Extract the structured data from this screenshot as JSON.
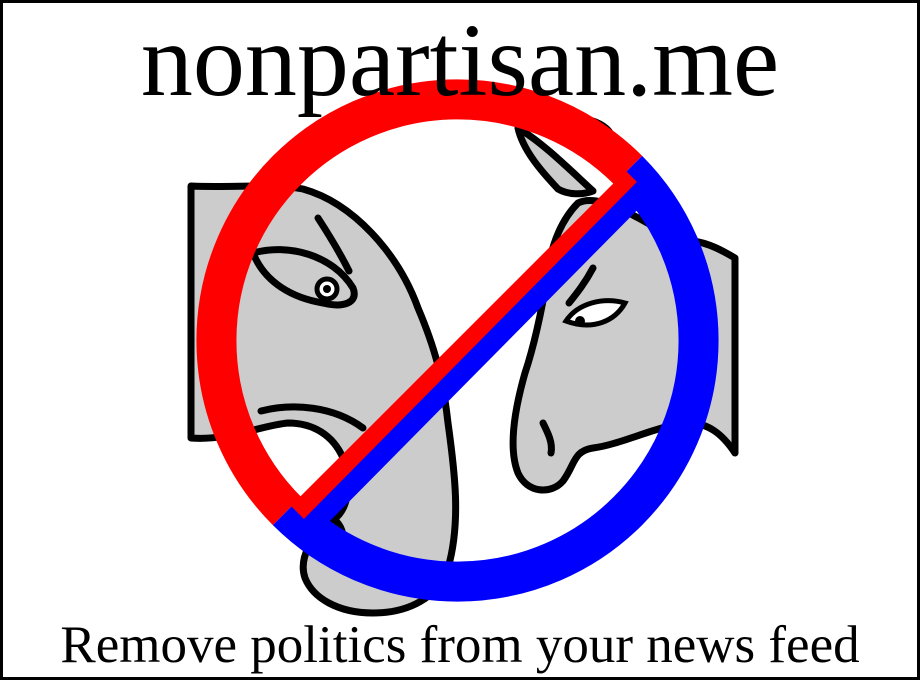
{
  "logo": {
    "title": "nonpartisan.me",
    "tagline": "Remove politics from your news feed"
  },
  "icons": {
    "elephant": "elephant-icon",
    "donkey": "donkey-icon",
    "prohibition": "no-symbol-icon"
  },
  "colors": {
    "prohibition_red": "#ff0000",
    "prohibition_blue": "#0000ff",
    "animal_fill": "#cccccc",
    "outline": "#000000",
    "background": "#ffffff"
  }
}
